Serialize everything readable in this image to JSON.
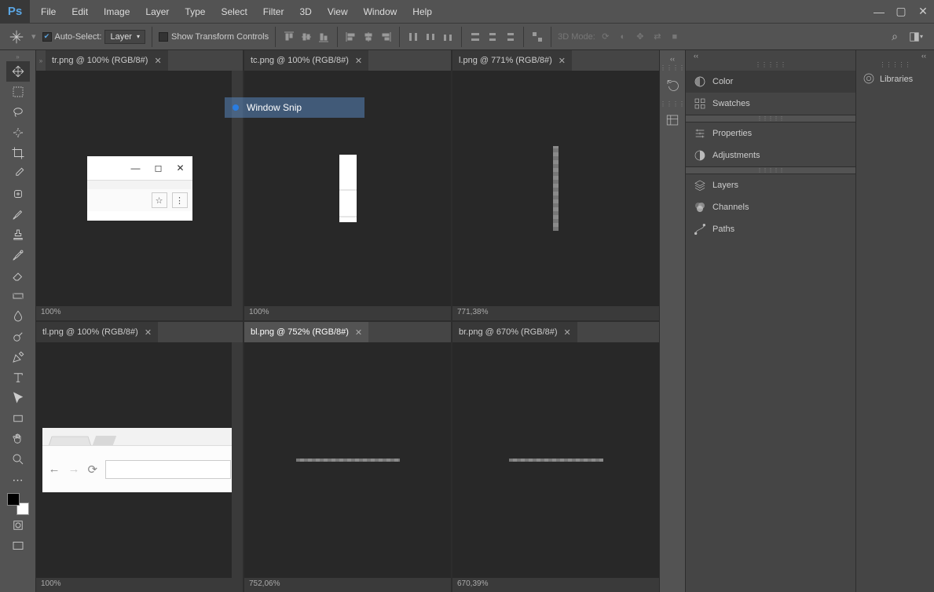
{
  "app": {
    "logo": "Ps"
  },
  "menubar": [
    "File",
    "Edit",
    "Image",
    "Layer",
    "Type",
    "Select",
    "Filter",
    "3D",
    "View",
    "Window",
    "Help"
  ],
  "optionsbar": {
    "autoselect_label": "Auto-Select:",
    "autoselect_dropdown": "Layer",
    "transform_label": "Show Transform Controls",
    "mode3d_label": "3D Mode:"
  },
  "toolbox": [
    "move-tool",
    "marquee-tool",
    "lasso-tool",
    "quick-select-tool",
    "crop-tool",
    "eyedropper-tool",
    "healing-tool",
    "brush-tool",
    "stamp-tool",
    "history-brush-tool",
    "eraser-tool",
    "gradient-tool",
    "blur-tool",
    "dodge-tool",
    "pen-tool",
    "type-tool",
    "path-select-tool",
    "rectangle-tool",
    "hand-tool",
    "zoom-tool"
  ],
  "documents": [
    {
      "tab": "tr.png @ 100% (RGB/8#)",
      "active": false,
      "status": "100%",
      "content": "tr"
    },
    {
      "tab": "tc.png @ 100% (RGB/8#)",
      "active": false,
      "status": "100%",
      "content": "tc"
    },
    {
      "tab": "l.png @ 771% (RGB/8#)",
      "active": false,
      "status": "771,38%",
      "content": "l"
    },
    {
      "tab": "tl.png @ 100% (RGB/8#)",
      "active": false,
      "status": "100%",
      "content": "tl"
    },
    {
      "tab": "bl.png @ 752% (RGB/8#)",
      "active": true,
      "status": "752,06%",
      "content": "bl"
    },
    {
      "tab": "br.png @ 670% (RGB/8#)",
      "active": false,
      "status": "670,39%",
      "content": "br"
    }
  ],
  "overlay": {
    "label": "Window Snip"
  },
  "panels_left_strip": [
    "history-panel-icon",
    "actions-panel-icon"
  ],
  "right_panels": [
    {
      "label": "Color",
      "icon": "color-icon",
      "active": true
    },
    {
      "label": "Swatches",
      "icon": "swatches-icon",
      "active": false
    }
  ],
  "right_panels2": [
    {
      "label": "Properties",
      "icon": "properties-icon"
    },
    {
      "label": "Adjustments",
      "icon": "adjustments-icon"
    }
  ],
  "right_panels3": [
    {
      "label": "Layers",
      "icon": "layers-icon"
    },
    {
      "label": "Channels",
      "icon": "channels-icon"
    },
    {
      "label": "Paths",
      "icon": "paths-icon"
    }
  ],
  "libraries_label": "Libraries"
}
